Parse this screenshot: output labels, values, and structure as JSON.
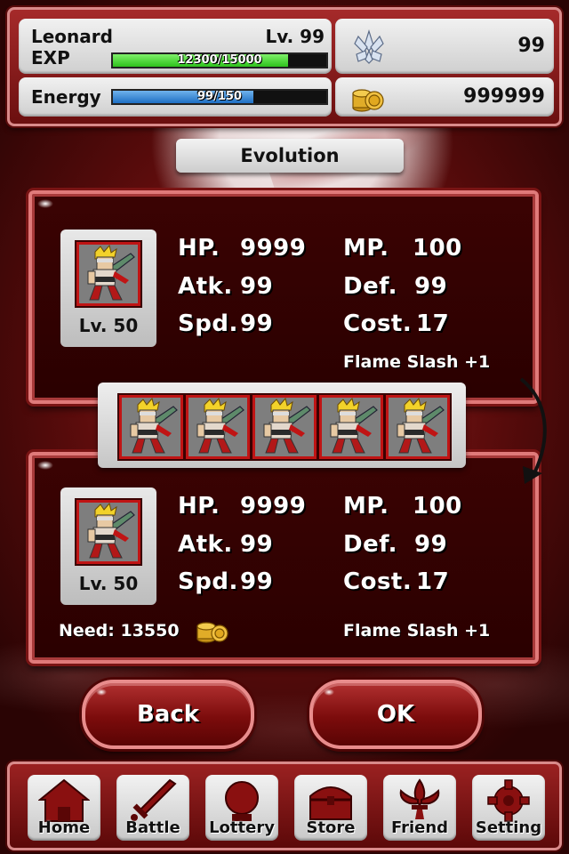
{
  "player": {
    "name": "Leonard",
    "level": "Lv. 99",
    "exp_label": "EXP",
    "exp_text": "12300/15000",
    "exp_fraction": 0.82,
    "energy_label": "Energy",
    "energy_text": "99/150",
    "energy_fraction": 0.66
  },
  "resources": {
    "crystal_icon": "crystal-icon",
    "crystals": "99",
    "coin_icon": "coin-stack-icon",
    "coins": "999999"
  },
  "screen_title": "Evolution",
  "current_card": {
    "level": "Lv. 50",
    "hp_label": "HP.",
    "hp": "9999",
    "mp_label": "MP.",
    "mp": "100",
    "atk_label": "Atk.",
    "atk": "99",
    "def_label": "Def.",
    "def": "99",
    "spd_label": "Spd.",
    "spd": "99",
    "cost_label": "Cost.",
    "cost": "17",
    "skill": "Flame Slash +1"
  },
  "material_count": 5,
  "evolved_card": {
    "level": "Lv. 50",
    "hp_label": "HP.",
    "hp": "9999",
    "mp_label": "MP.",
    "mp": "100",
    "atk_label": "Atk.",
    "atk": "99",
    "def_label": "Def.",
    "def": "99",
    "spd_label": "Spd.",
    "spd": "99",
    "cost_label": "Cost.",
    "cost": "17",
    "skill": "Flame Slash +1",
    "need_text": "Need: 13550"
  },
  "buttons": {
    "back": "Back",
    "ok": "OK"
  },
  "nav": [
    {
      "label": "Home",
      "icon": "house-icon"
    },
    {
      "label": "Battle",
      "icon": "sword-icon"
    },
    {
      "label": "Lottery",
      "icon": "lottery-ball-icon"
    },
    {
      "label": "Store",
      "icon": "treasure-chest-icon"
    },
    {
      "label": "Friend",
      "icon": "fleur-de-lis-icon"
    },
    {
      "label": "Setting",
      "icon": "gear-icon"
    }
  ],
  "colors": {
    "exp_bar": "#2ec21c",
    "energy_bar": "#1e6fc4",
    "card_border": "#e07a7a",
    "slot_border": "#c01414"
  }
}
